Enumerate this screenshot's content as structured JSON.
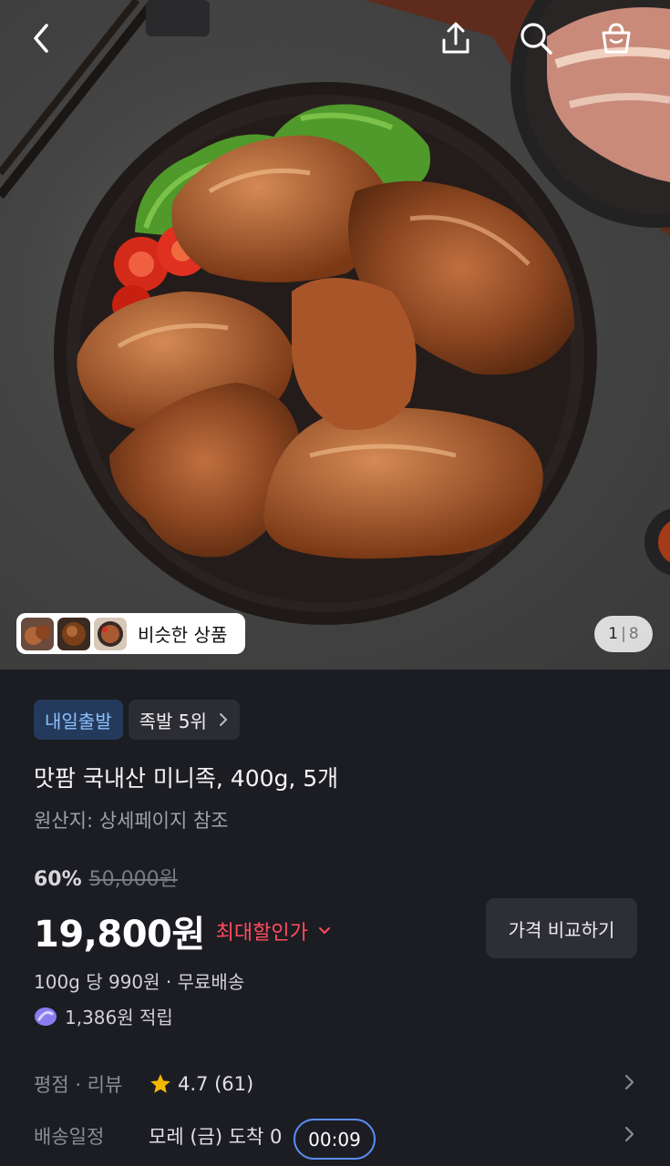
{
  "hero": {
    "similar_label": "비슷한 상품",
    "pager": {
      "current": "1",
      "separator": "|",
      "total": "8"
    },
    "icons": [
      "back-arrow-icon",
      "share-icon",
      "search-icon",
      "cart-icon"
    ]
  },
  "product": {
    "badges": {
      "delivery": "내일출발",
      "rank": "족발 5위"
    },
    "title": "맛팜 국내산 미니족, 400g, 5개",
    "origin": "원산지: 상세페이지 참조",
    "discount_pct": "60%",
    "original_price": "50,000원",
    "price": "19,800원",
    "price_tag": "최대할인가",
    "compare_button": "가격 비교하기",
    "unit_price": "100g 당 990원 · 무료배송",
    "points": "1,386원 적립"
  },
  "details": {
    "rating_label": "평점 · 리뷰",
    "rating_value": "4.7 (61)",
    "shipping_label": "배송일정",
    "shipping_value": "모레 (금) 도착 0",
    "timer": "00:09"
  },
  "colors": {
    "accent_red": "#ff4d5e",
    "badge_blue": "#8ec0ff",
    "timer_border": "#5a8df0",
    "star": "#f5b800"
  }
}
